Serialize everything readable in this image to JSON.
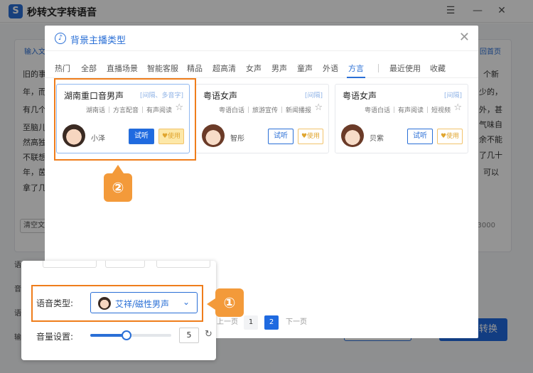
{
  "app": {
    "title": "秒转文字转语音",
    "logo_letter": "S"
  },
  "window_controls": {
    "menu": "☰",
    "minimize": "—",
    "close": "✕"
  },
  "background": {
    "input_tab": "输入文",
    "next_page": "回首页",
    "left_text": [
      "旧的事",
      "年，而",
      "有几个",
      "至脑儿",
      "然高独",
      "不联想",
      "年，茵",
      "拿了几"
    ],
    "right_text": [
      "个新",
      "少的，",
      "外，甚",
      "气味自",
      "余不能",
      "了几十",
      "可以"
    ],
    "clear_label": "清空文",
    "count_label": "/ 3000",
    "row_labels": [
      "语音",
      "音",
      "语",
      "输"
    ],
    "convert_label": "转换"
  },
  "modal": {
    "title": "背景主播类型",
    "note_icon": "♪",
    "close_icon": "✕",
    "tabs": [
      "热门",
      "全部",
      "直播场景",
      "智能客服",
      "精品",
      "超高清",
      "女声",
      "男声",
      "童声",
      "外语",
      "方言",
      "最近使用",
      "收藏"
    ],
    "active_tab": "方言",
    "cards": [
      {
        "name": "湖南重口音男声",
        "tag": "[间隔、多音字]",
        "subtags": [
          "湖南话",
          "方言配音",
          "有声阅读"
        ],
        "voice": "小泽",
        "try_label": "试听",
        "use_label": "♥使用",
        "gender": "male"
      },
      {
        "name": "粤语女声",
        "tag": "[间隔]",
        "subtags": [
          "粤语白话",
          "旅游宣传",
          "新闻播报"
        ],
        "voice": "智彤",
        "try_label": "试听",
        "use_label": "♥使用",
        "gender": "female"
      },
      {
        "name": "粤语女声",
        "tag": "[间隔]",
        "subtags": [
          "粤语白话",
          "有声阅读",
          "短视频"
        ],
        "voice": "贝紫",
        "try_label": "试听",
        "use_label": "♥使用",
        "gender": "female"
      }
    ],
    "pagination": {
      "prev": "上一页",
      "pages": [
        "1",
        "2"
      ],
      "current": "2",
      "next": "下一页"
    }
  },
  "callouts": {
    "one": "①",
    "two": "②"
  },
  "settings": {
    "voice_type_label": "语音类型:",
    "voice_type_value": "艾祥/磁性男声",
    "volume_label": "音量设置:",
    "volume_value": "5",
    "volume_fraction": 0.45
  },
  "colors": {
    "accent": "#2a6fd6",
    "callout": "#ef7d1b",
    "gold": "#e0a52e"
  }
}
